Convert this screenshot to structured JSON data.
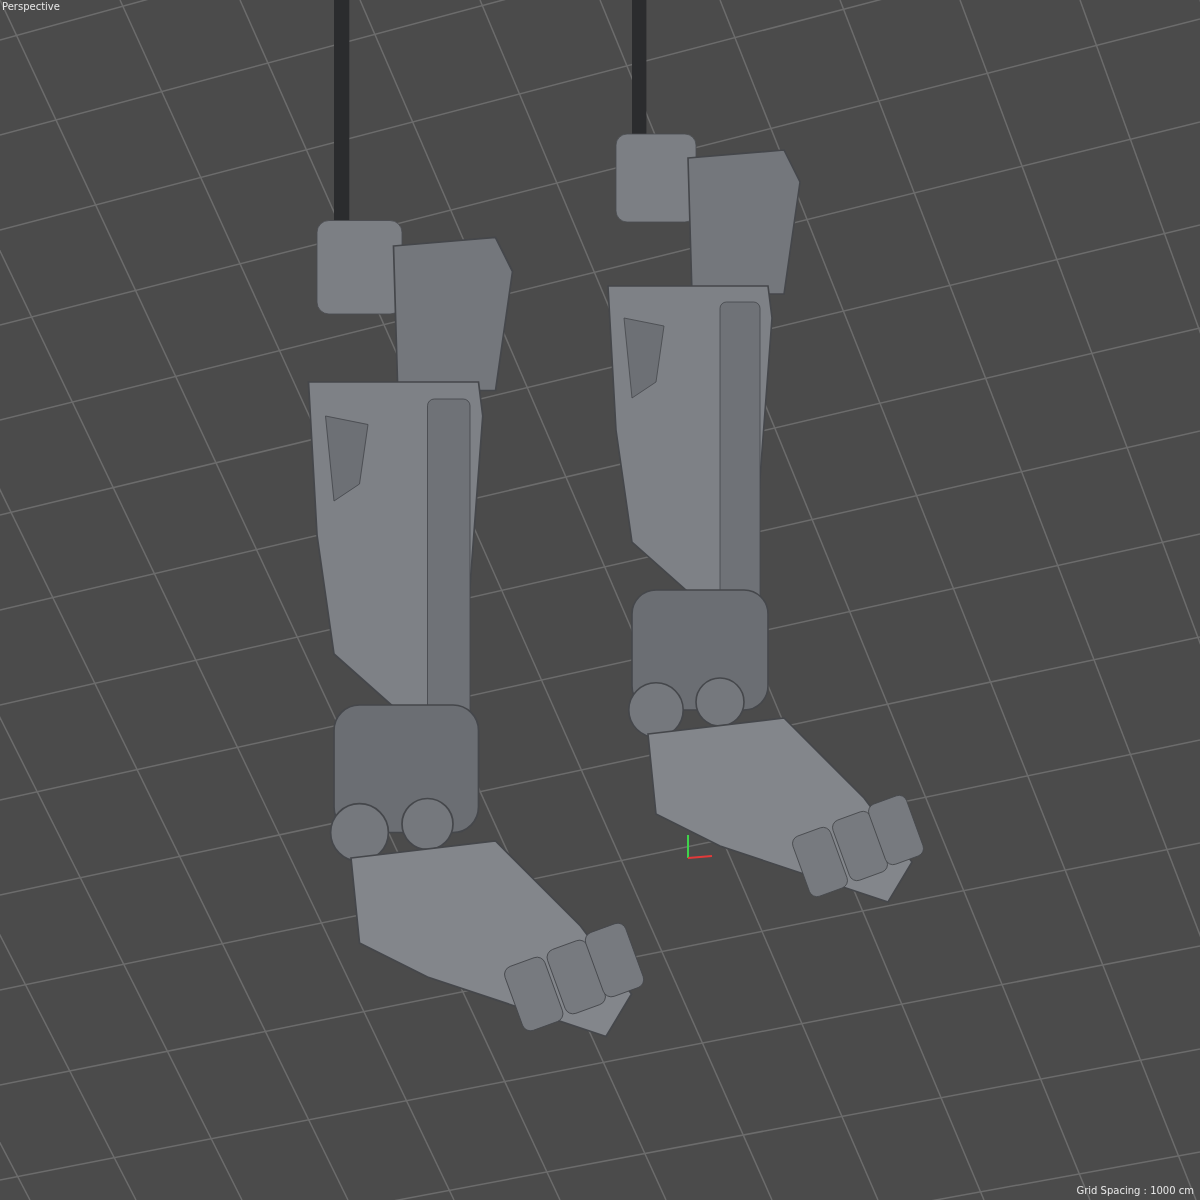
{
  "viewport": {
    "camera_label": "Perspective",
    "grid_spacing": "Grid Spacing : 1000 cm"
  }
}
